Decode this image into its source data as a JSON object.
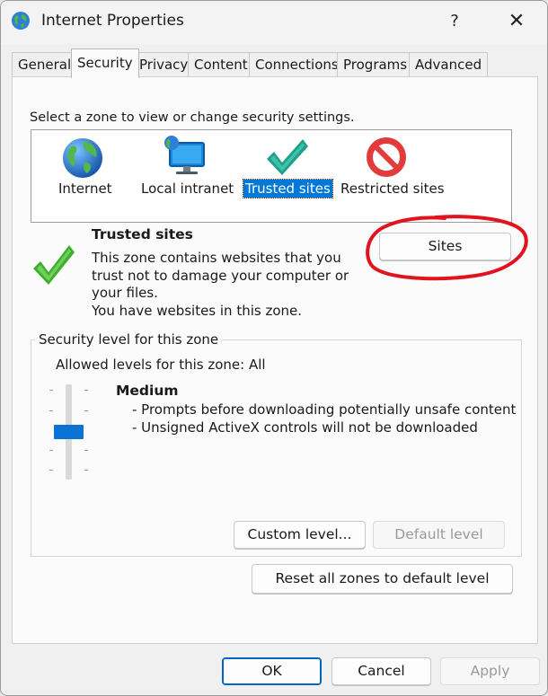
{
  "window": {
    "title": "Internet Properties",
    "help_label": "?",
    "close_label": "✕"
  },
  "tabs": [
    {
      "label": "General"
    },
    {
      "label": "Security",
      "active": true
    },
    {
      "label": "Privacy"
    },
    {
      "label": "Content"
    },
    {
      "label": "Connections"
    },
    {
      "label": "Programs"
    },
    {
      "label": "Advanced"
    }
  ],
  "zones": {
    "prompt": "Select a zone to view or change security settings.",
    "items": [
      {
        "label": "Internet",
        "icon": "globe-icon"
      },
      {
        "label": "Local intranet",
        "icon": "network-computer-icon"
      },
      {
        "label": "Trusted sites",
        "icon": "checkmark-icon",
        "selected": true
      },
      {
        "label": "Restricted sites",
        "icon": "prohibited-icon"
      }
    ]
  },
  "zone_info": {
    "title": "Trusted sites",
    "description_lines": [
      "This zone contains websites that you",
      "trust not to damage your computer or",
      "your files.",
      "You have websites in this zone."
    ],
    "sites_button": "Sites"
  },
  "security_level": {
    "group_label": "Security level for this zone",
    "allowed": "Allowed levels for this zone: All",
    "level_name": "Medium",
    "level_points": [
      "- Prompts before downloading potentially unsafe content",
      "- Unsigned ActiveX controls will not be downloaded"
    ],
    "custom_button": "Custom level...",
    "default_button": "Default level"
  },
  "reset_button": "Reset all zones to default level",
  "footer": {
    "ok": "OK",
    "cancel": "Cancel",
    "apply": "Apply"
  },
  "colors": {
    "selection": "#0078d7",
    "slider": "#0a74d4",
    "annotation": "#e0141e",
    "check": "#3cb83c"
  }
}
